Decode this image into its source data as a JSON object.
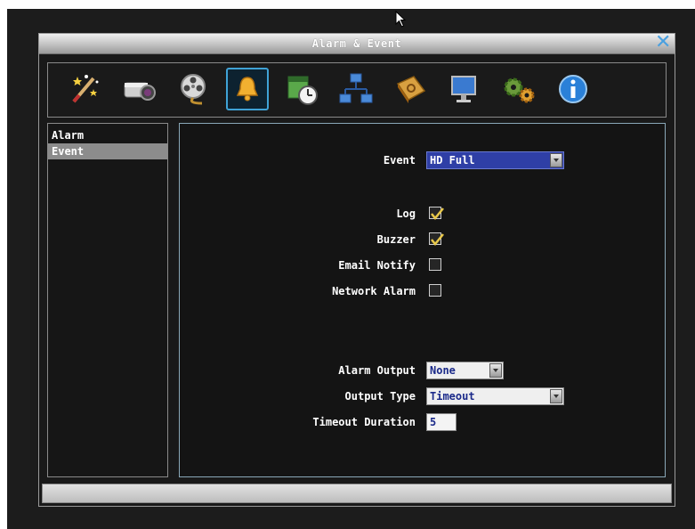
{
  "window": {
    "title": "Alarm & Event"
  },
  "toolbar": {
    "icons": [
      "wizard-icon",
      "camera-icon",
      "film-reel-icon",
      "bell-icon",
      "schedule-icon",
      "network-icon",
      "book-icon",
      "monitor-icon",
      "gears-icon",
      "info-icon"
    ],
    "selected": "bell-icon"
  },
  "sidebar": {
    "items": [
      {
        "label": "Alarm",
        "active": false
      },
      {
        "label": "Event",
        "active": true
      }
    ]
  },
  "form": {
    "event": {
      "label": "Event",
      "value": "HD Full"
    },
    "log": {
      "label": "Log",
      "checked": true
    },
    "buzzer": {
      "label": "Buzzer",
      "checked": true
    },
    "email_notify": {
      "label": "Email Notify",
      "checked": false
    },
    "network_alarm": {
      "label": "Network Alarm",
      "checked": false
    },
    "alarm_output": {
      "label": "Alarm Output",
      "value": "None"
    },
    "output_type": {
      "label": "Output Type",
      "value": "Timeout"
    },
    "timeout_duration": {
      "label": "Timeout Duration",
      "value": "5"
    }
  },
  "colors": {
    "accent": "#3fa2d6",
    "selected_dropdown": "#2f3fa6",
    "check": "#e8c84a"
  }
}
